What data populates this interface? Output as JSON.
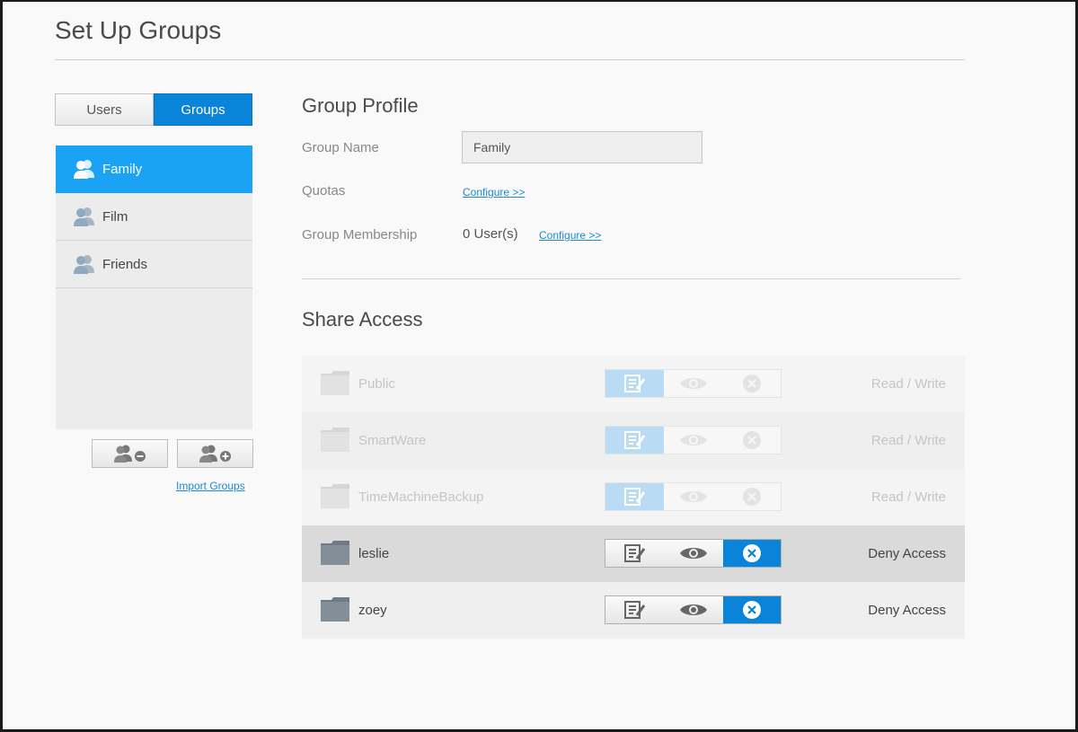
{
  "page": {
    "title": "Set Up Groups"
  },
  "toggle": {
    "users_label": "Users",
    "groups_label": "Groups",
    "selected": "Groups"
  },
  "groups": [
    {
      "name": "Family",
      "selected": true
    },
    {
      "name": "Film",
      "selected": false
    },
    {
      "name": "Friends",
      "selected": false
    }
  ],
  "group_actions": {
    "remove_icon": "remove-group-icon",
    "add_icon": "add-group-icon",
    "import_label": "Import Groups"
  },
  "profile": {
    "title": "Group Profile",
    "group_name_label": "Group Name",
    "group_name_value": "Family",
    "quotas_label": "Quotas",
    "quotas_link": "Configure >>",
    "membership_label": "Group Membership",
    "membership_value": "0 User(s)",
    "membership_link": "Configure >>"
  },
  "share_access": {
    "title": "Share Access",
    "shares": [
      {
        "name": "Public",
        "permission": "Read / Write",
        "selected": "write",
        "enabled": false
      },
      {
        "name": "SmartWare",
        "permission": "Read / Write",
        "selected": "write",
        "enabled": false
      },
      {
        "name": "TimeMachineBackup",
        "permission": "Read / Write",
        "selected": "write",
        "enabled": false
      },
      {
        "name": "leslie",
        "permission": "Deny Access",
        "selected": "deny",
        "enabled": true
      },
      {
        "name": "zoey",
        "permission": "Deny Access",
        "selected": "deny",
        "enabled": true
      }
    ]
  },
  "colors": {
    "accent": "#0a84d8",
    "selected_row": "#1aa3f5",
    "link": "#1a8ad6"
  }
}
